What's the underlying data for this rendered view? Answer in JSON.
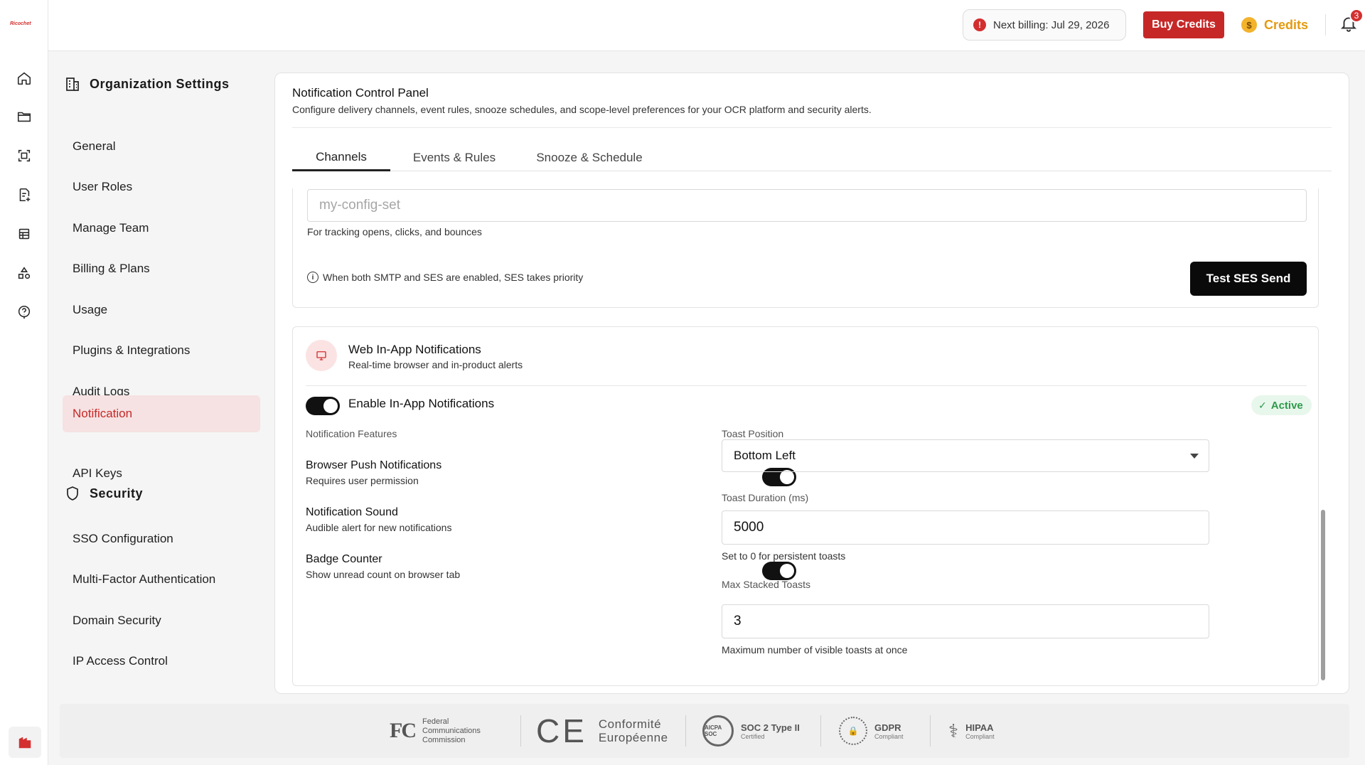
{
  "brand": {
    "logo_text": "Ricochet"
  },
  "topbar": {
    "billing": "Next billing: Jul 29, 2026",
    "billing_icon": "!",
    "buy_credits": "Buy Credits",
    "credits": "Credits",
    "coin_symbol": "$",
    "notification_count": "3"
  },
  "sidebar": {
    "org_heading": "Organization Settings",
    "org_items": [
      "General",
      "User Roles",
      "Manage Team",
      "Billing & Plans",
      "Usage",
      "Plugins & Integrations",
      "Audit Logs",
      "Notification",
      "API Keys"
    ],
    "active_item": "Notification",
    "security_heading": "Security",
    "security_items": [
      "SSO Configuration",
      "Multi-Factor Authentication",
      "Domain Security",
      "IP Access Control"
    ]
  },
  "panel": {
    "title": "Notification Control Panel",
    "subtitle": "Configure delivery channels, event rules, snooze schedules, and scope-level preferences for your OCR platform and security alerts.",
    "tabs": [
      "Channels",
      "Events & Rules",
      "Snooze & Schedule"
    ],
    "active_tab": "Channels"
  },
  "ses": {
    "config_placeholder": "my-config-set",
    "config_hint": "For tracking opens, clicks, and bounces",
    "priority_icon": "i",
    "priority_note": "When both SMTP and SES are enabled, SES takes priority",
    "test_button": "Test SES Send"
  },
  "inapp": {
    "title": "Web In-App Notifications",
    "subtitle": "Real-time browser and in-product alerts",
    "enable_label": "Enable In-App Notifications",
    "enabled": true,
    "status": "Active",
    "status_check": "✓",
    "features_heading": "Notification Features",
    "features": [
      {
        "title": "Browser Push Notifications",
        "desc": "Requires user permission",
        "on": true
      },
      {
        "title": "Notification Sound",
        "desc": "Audible alert for new notifications",
        "on": true
      },
      {
        "title": "Badge Counter",
        "desc": "Show unread count on browser tab",
        "on": true
      }
    ],
    "toast_position_label": "Toast Position",
    "toast_position": "Bottom Left",
    "toast_duration_label": "Toast Duration (ms)",
    "toast_duration": "5000",
    "toast_duration_hint": "Set to 0 for persistent toasts",
    "max_stacked_label": "Max Stacked Toasts",
    "max_stacked": "3",
    "max_stacked_hint": "Maximum number of visible toasts at once"
  },
  "compliance": {
    "fcc_mark": "FC",
    "fcc_lines": [
      "Federal",
      "Communications",
      "Commission"
    ],
    "ce_mark": "CE",
    "ce_lines": [
      "Conformité",
      "Européenne"
    ],
    "soc_logo": "AICPA SOC",
    "soc_title": "SOC 2 Type II",
    "soc_sub": "Certified",
    "gdpr_logo": "🔒",
    "gdpr_title": "GDPR",
    "gdpr_sub": "Compliant",
    "hipaa_logo": "⚕",
    "hipaa_title": "HIPAA",
    "hipaa_sub": "Compliant"
  },
  "colors": {
    "accent": "#c62828",
    "active_bg": "#f6e2e2",
    "success": "#2e9a4a",
    "coin": "#e59a10"
  },
  "icons": {
    "rail": [
      "home-icon",
      "folder-icon",
      "scan-icon",
      "document-add-icon",
      "table-icon",
      "shapes-icon",
      "help-circle-icon"
    ],
    "org": "building-icon"
  }
}
